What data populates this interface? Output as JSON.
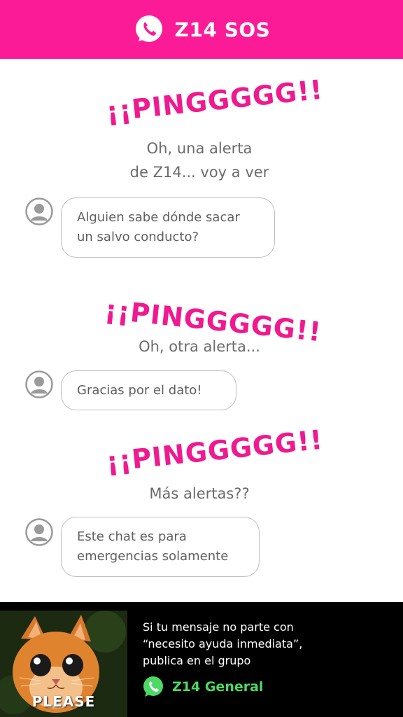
{
  "header": {
    "title": "Z14 SOS",
    "icon": "whatsapp-phone-icon",
    "color": "#fc1b97"
  },
  "story": [
    {
      "ping": "¡¡PINGGGGG!!",
      "caption_lines": [
        "Oh, una alerta",
        "de Z14... voy a ver"
      ],
      "message_lines": [
        "Alguien sabe dónde sacar",
        "un salvo conducto?"
      ]
    },
    {
      "ping": "¡¡PINGGGGG!!",
      "caption_lines": [
        "Oh, otra alerta..."
      ],
      "message_lines": [
        "Gracias por el dato!"
      ]
    },
    {
      "ping": "¡¡PINGGGGG!!",
      "caption_lines": [
        "Más alertas??"
      ],
      "message_lines": [
        "Este chat es para",
        "emergencias solamente"
      ]
    }
  ],
  "avatar_icon": "user-avatar-icon",
  "footer": {
    "image_caption": "PLEASE",
    "text_lines": [
      "Si tu mensaje no parte con",
      "“necesito ayuda inmediata”,",
      "publica en el grupo"
    ],
    "group_name": "Z14 General",
    "group_icon": "whatsapp-icon",
    "group_color": "#4cd964"
  },
  "colors": {
    "accent": "#f0198f",
    "caption": "#6b6b6b",
    "bubble_border": "#bfbfbf"
  }
}
